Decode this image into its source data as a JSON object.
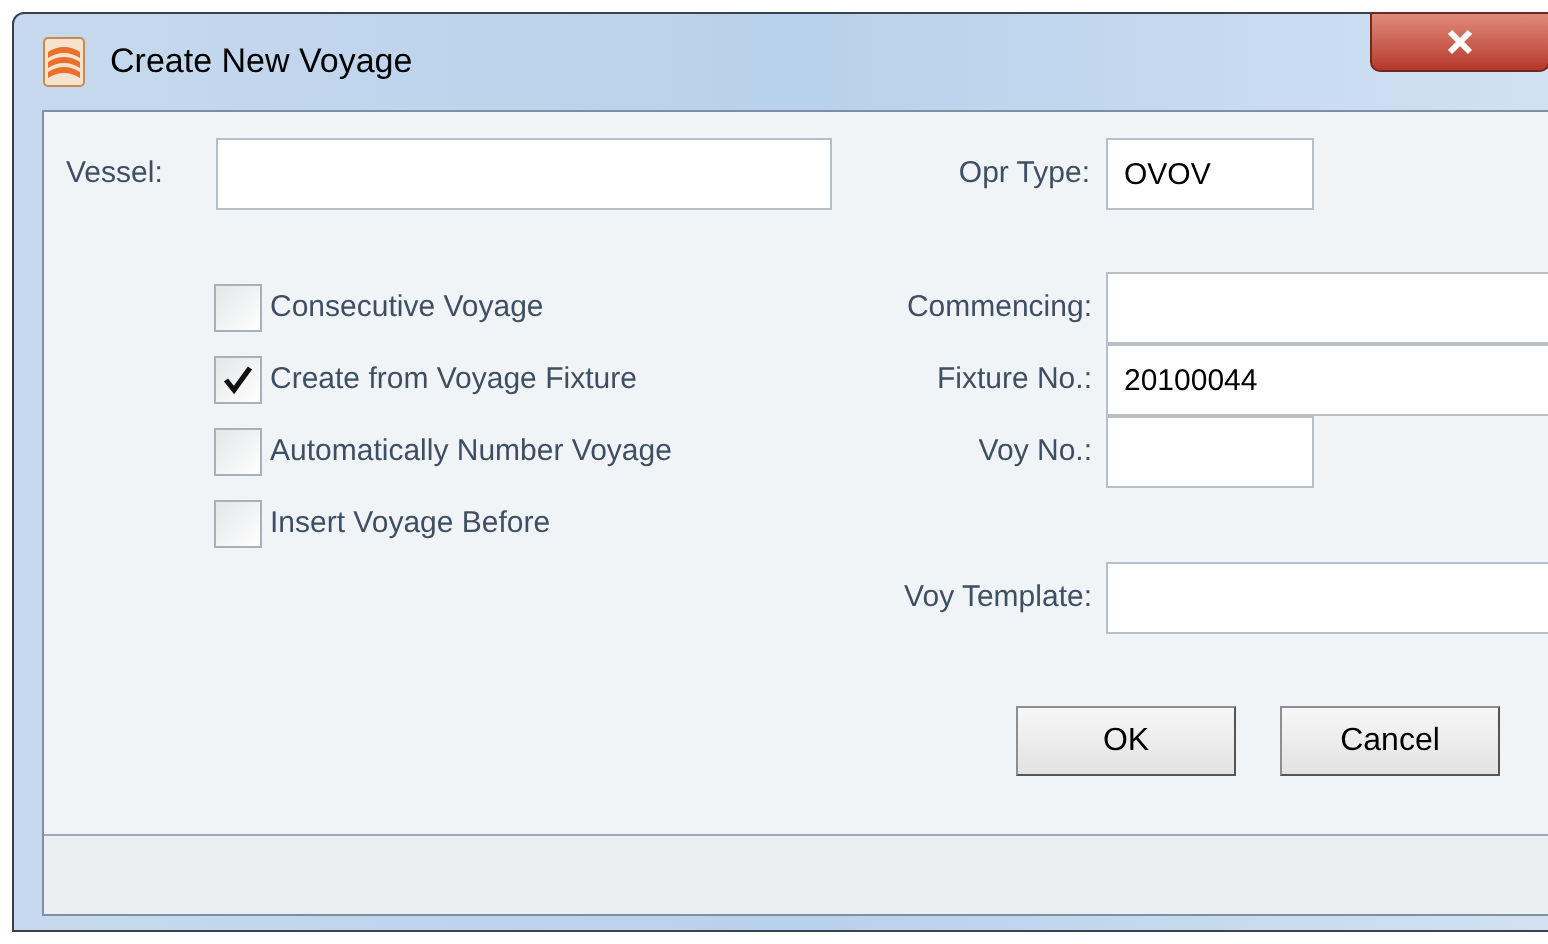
{
  "window": {
    "title": "Create New Voyage"
  },
  "vessel": {
    "label": "Vessel:"
  },
  "opr_type": {
    "label": "Opr Type:",
    "value": "OVOV"
  },
  "rows": [
    {
      "checkbox": {
        "label": "Consecutive Voyage",
        "checked": false
      },
      "field": {
        "label": "Commencing:",
        "kind": "wide"
      }
    },
    {
      "checkbox": {
        "label": "Create from Voyage Fixture",
        "checked": true
      },
      "field": {
        "label": "Fixture No.:",
        "value": "20100044",
        "kind": "wide"
      }
    },
    {
      "checkbox": {
        "label": "Automatically Number Voyage",
        "checked": false
      },
      "field": {
        "label": "Voy No.:",
        "kind": "narrow"
      }
    },
    {
      "checkbox": {
        "label": "Insert Voyage Before",
        "checked": false
      }
    },
    {
      "field": {
        "label": "Voy Template:",
        "kind": "wide"
      }
    }
  ],
  "buttons": [
    "OK",
    "Cancel"
  ]
}
